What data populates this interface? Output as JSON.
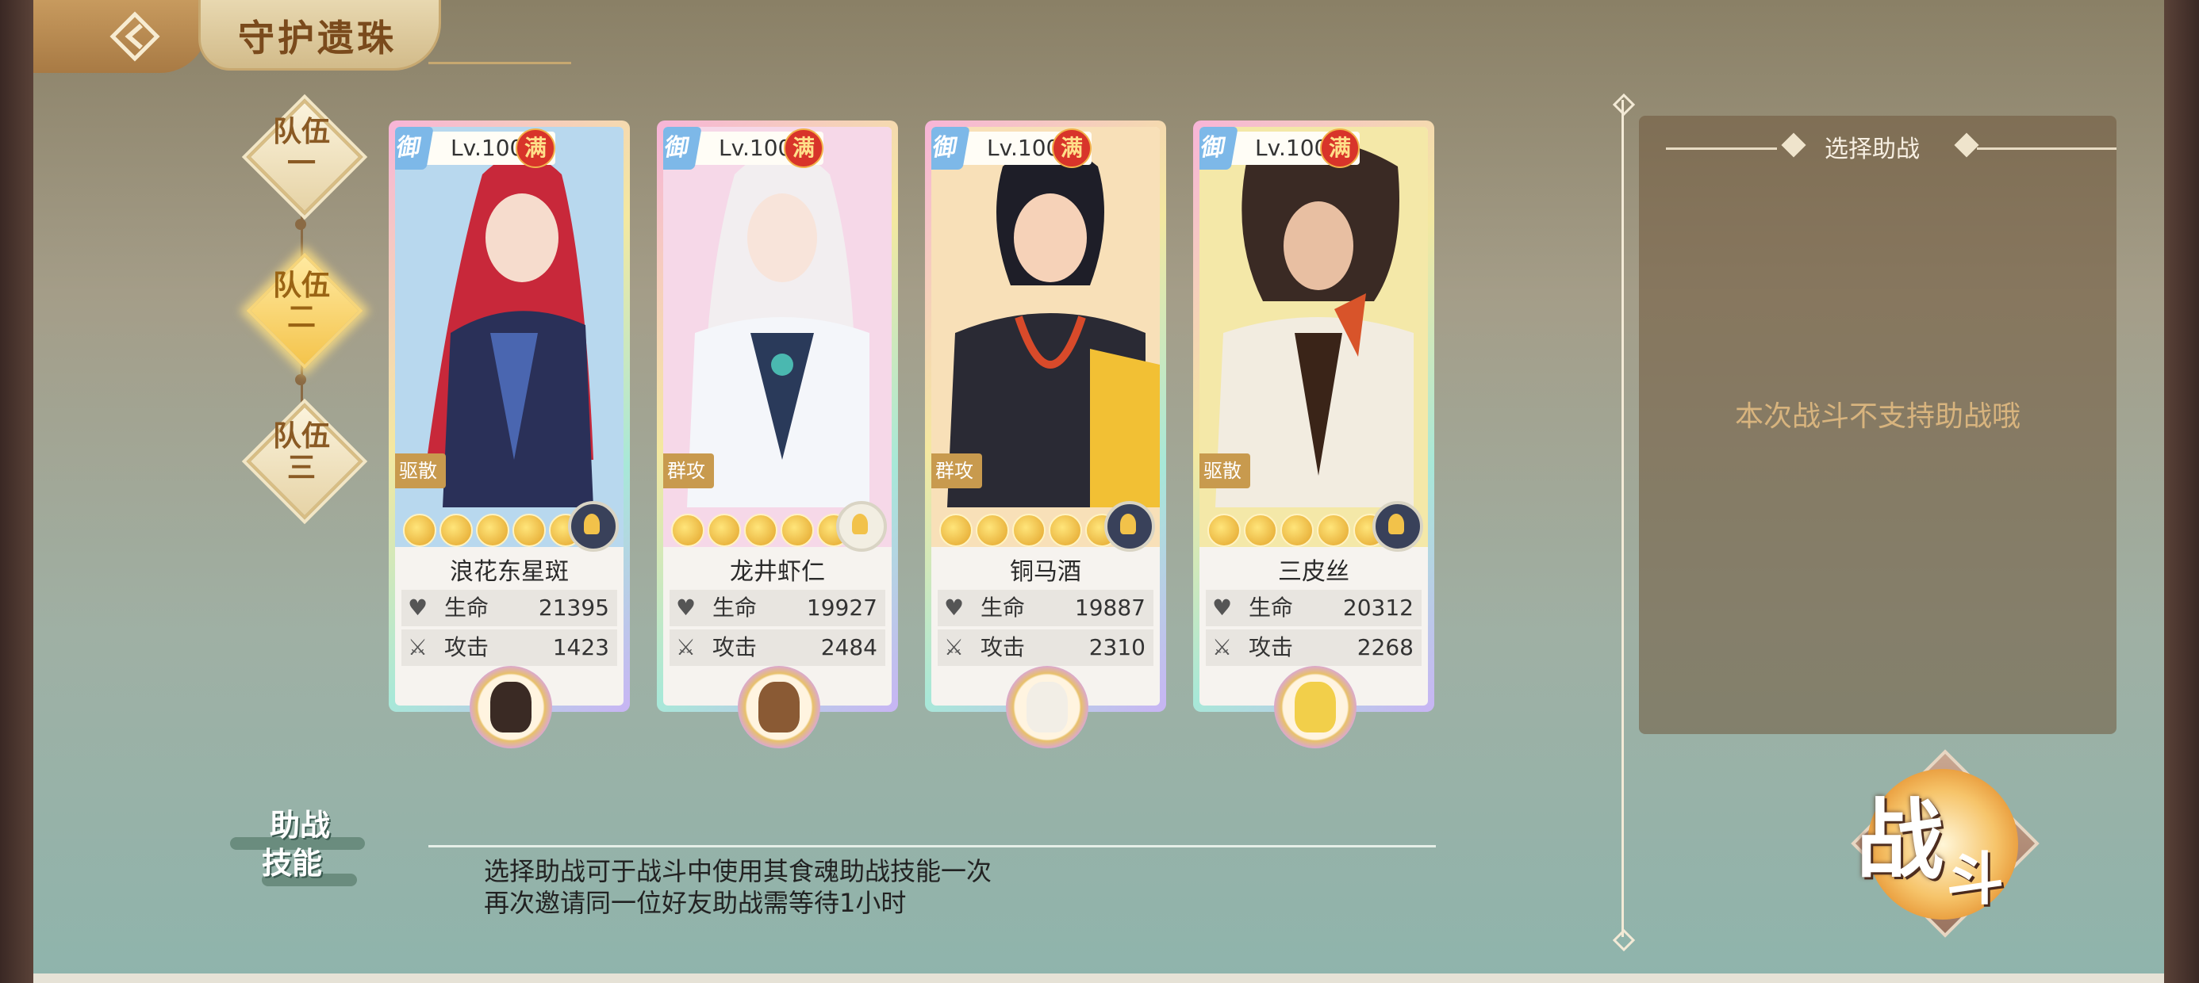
{
  "header": {
    "title": "守护遗珠",
    "back_icon": "back-arrow-icon"
  },
  "teams": [
    {
      "label_top": "队伍",
      "label_bottom": "一",
      "active": false
    },
    {
      "label_top": "队伍",
      "label_bottom": "二",
      "active": true
    },
    {
      "label_top": "队伍",
      "label_bottom": "三",
      "active": false
    }
  ],
  "cards": [
    {
      "badge": "御",
      "level": "Lv.100",
      "max_tag": "满",
      "role": "驱散",
      "stars": 5,
      "element": "dark",
      "name": "浪花东星斑",
      "hp_label": "生命",
      "hp": "21395",
      "atk_label": "攻击",
      "atk": "1423"
    },
    {
      "badge": "御",
      "level": "Lv.100",
      "max_tag": "满",
      "role": "群攻",
      "stars": 5,
      "element": "light",
      "name": "龙井虾仁",
      "hp_label": "生命",
      "hp": "19927",
      "atk_label": "攻击",
      "atk": "2484"
    },
    {
      "badge": "御",
      "level": "Lv.100",
      "max_tag": "满",
      "role": "群攻",
      "stars": 5,
      "element": "dark",
      "name": "铜马酒",
      "hp_label": "生命",
      "hp": "19887",
      "atk_label": "攻击",
      "atk": "2310"
    },
    {
      "badge": "御",
      "level": "Lv.100",
      "max_tag": "满",
      "role": "驱散",
      "stars": 5,
      "element": "dark",
      "name": "三皮丝",
      "hp_label": "生命",
      "hp": "20312",
      "atk_label": "攻击",
      "atk": "2268"
    }
  ],
  "assist_panel": {
    "title": "选择助战",
    "message": "本次战斗不支持助战哦"
  },
  "battle_button": {
    "char1": "战",
    "char2": "斗"
  },
  "skill": {
    "badge_top": "助战",
    "badge_bottom": "技能",
    "line1": "选择助战可于战斗中使用其食魂助战技能一次",
    "line2": "再次邀请同一位好友助战需等待1小时"
  },
  "colors": {
    "accent": "#d8b47e",
    "panel": "#70583c",
    "star": "#f2c24a"
  }
}
